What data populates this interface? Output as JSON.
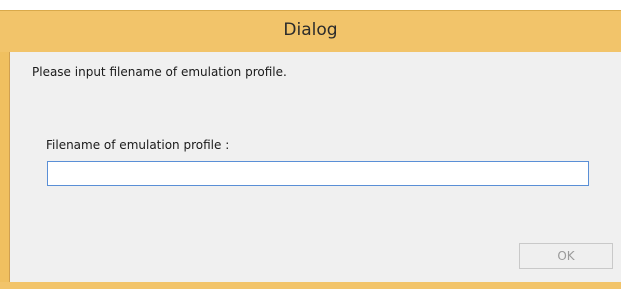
{
  "window": {
    "title": "Dialog"
  },
  "dialog": {
    "prompt": "Please input filename of emulation profile.",
    "field_label": "Filename of emulation profile :",
    "field_value": "",
    "ok_label": "OK",
    "ok_enabled": false
  },
  "colors": {
    "titlebar": "#f2c46a",
    "client_background": "#f0f0f0",
    "input_border": "#5a8fd6",
    "disabled_text": "#9a9a9a"
  }
}
